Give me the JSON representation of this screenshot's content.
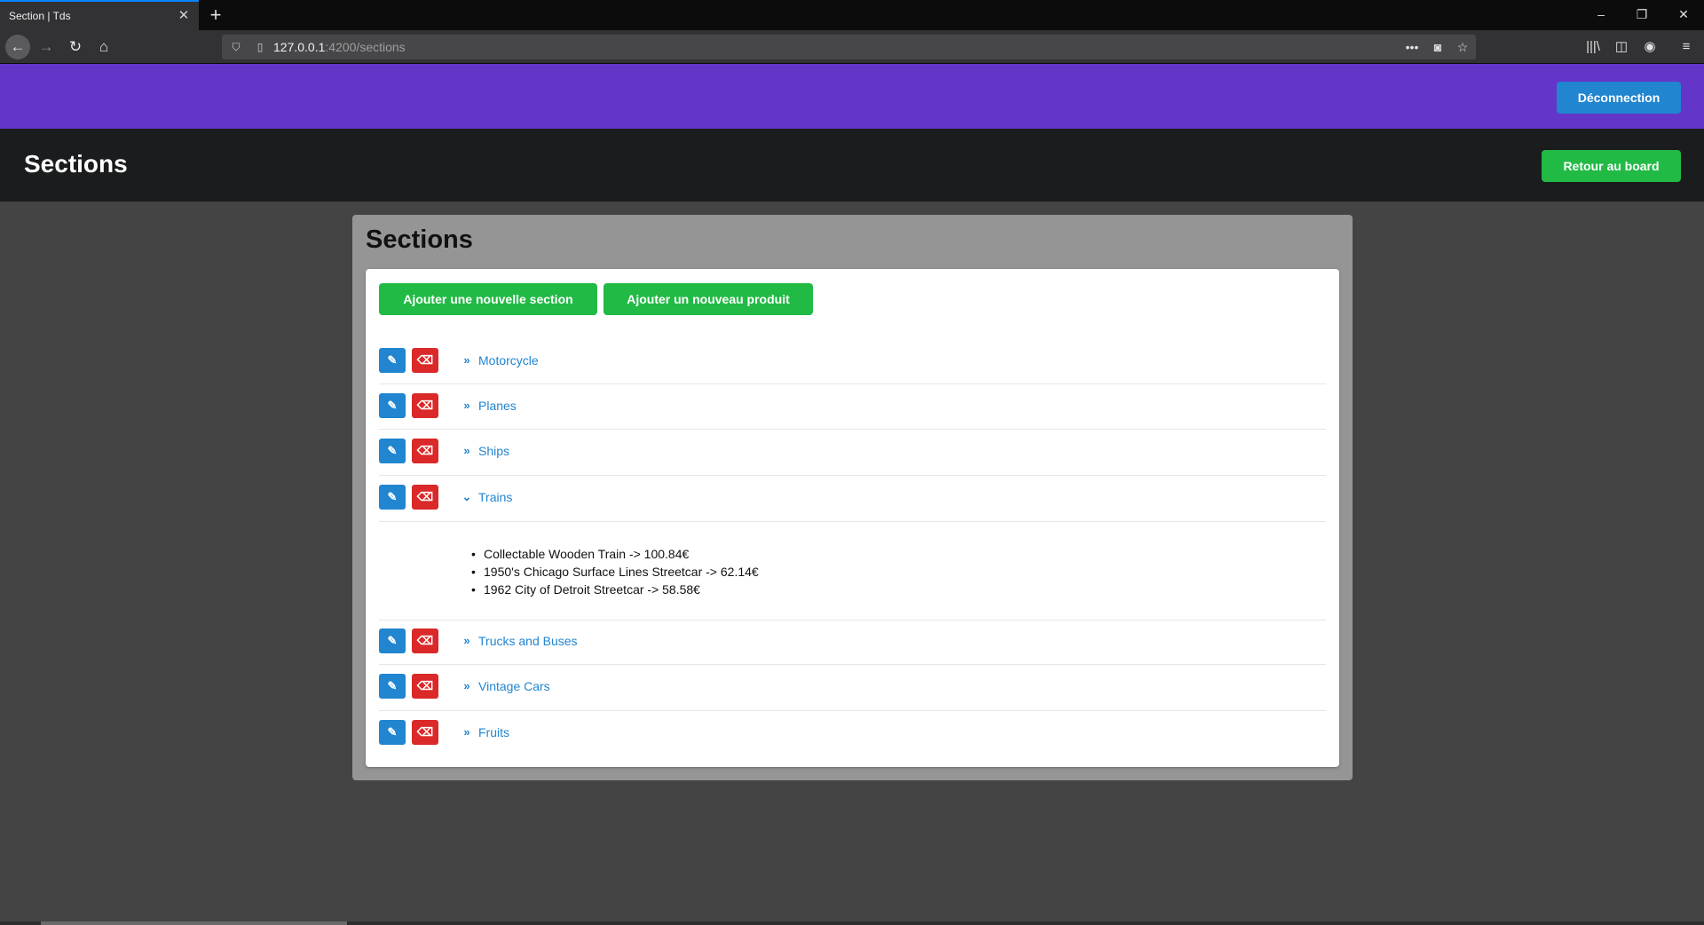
{
  "browser": {
    "tab_title": "Section | Tds",
    "tab_close": "✕",
    "new_tab": "+",
    "url_host": "127.0.0.1",
    "url_path": ":4200/sections",
    "controls": {
      "minimize": "–",
      "restore": "❐",
      "close": "✕"
    },
    "nav": {
      "back": "←",
      "forward": "→",
      "reload": "↻",
      "home": "⌂"
    },
    "icons": {
      "more": "•••",
      "pocket": "◙",
      "bookmark": "☆",
      "library": "|||\\",
      "sidebar": "◫",
      "account": "◉",
      "menu": "≡"
    }
  },
  "header": {
    "logout_label": "Déconnection",
    "page_title": "Sections",
    "back_label": "Retour au board"
  },
  "panel": {
    "title": "Sections",
    "add_section_label": "Ajouter une nouvelle section",
    "add_product_label": "Ajouter un nouveau produit"
  },
  "sections": [
    {
      "name": "Motorcycle",
      "expanded": false
    },
    {
      "name": "Planes",
      "expanded": false
    },
    {
      "name": "Ships",
      "expanded": false
    },
    {
      "name": "Trains",
      "expanded": true,
      "products": [
        "Collectable Wooden Train -> 100.84€",
        "1950's Chicago Surface Lines Streetcar -> 62.14€",
        "1962 City of Detroit Streetcar -> 58.58€"
      ]
    },
    {
      "name": "Trucks and Buses",
      "expanded": false
    },
    {
      "name": "Vintage Cars",
      "expanded": false
    },
    {
      "name": "Fruits",
      "expanded": false
    }
  ],
  "icons": {
    "edit": "✎",
    "delete": "⌫",
    "collapsed": "»",
    "expanded": "⌄",
    "bullet": "•"
  },
  "colors": {
    "purple": "#6435c9",
    "blue": "#2185d0",
    "green": "#21ba45",
    "red": "#db2828",
    "dark": "#1b1c1d"
  }
}
